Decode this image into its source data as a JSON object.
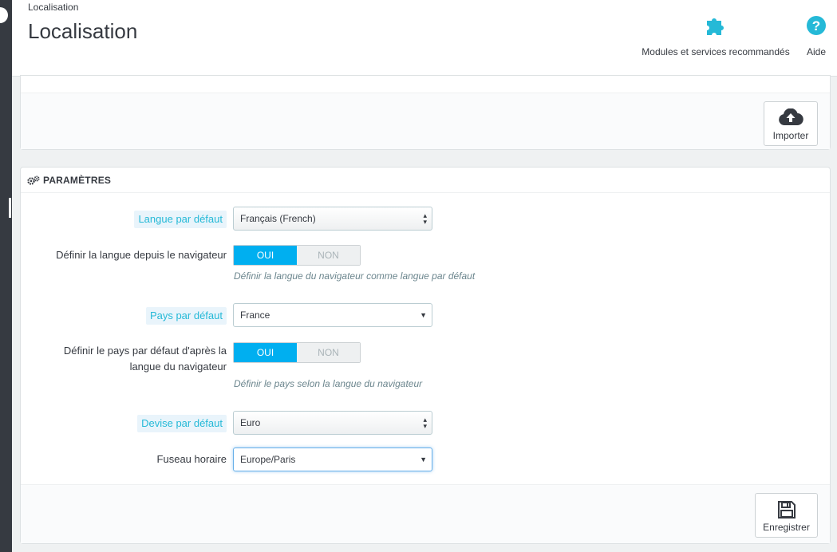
{
  "header": {
    "breadcrumb": "Localisation",
    "title": "Localisation",
    "toolbar": {
      "modules_label": "Modules et services recommandés",
      "help_label": "Aide"
    }
  },
  "import_panel": {
    "import_label": "Importer"
  },
  "params_panel": {
    "heading": "PARAMÈTRES",
    "fields": {
      "default_language": {
        "label": "Langue par défaut",
        "value": "Français (French)"
      },
      "browser_language": {
        "label": "Définir la langue depuis le navigateur",
        "on": "OUI",
        "off": "NON",
        "help": "Définir la langue du navigateur comme langue par défaut"
      },
      "default_country": {
        "label": "Pays par défaut",
        "value": "France"
      },
      "browser_country": {
        "label_line1": "Définir le pays par défaut d'après la",
        "label_line2": "langue du navigateur",
        "on": "OUI",
        "off": "NON",
        "help": "Définir le pays selon la langue du navigateur"
      },
      "default_currency": {
        "label": "Devise par défaut",
        "value": "Euro"
      },
      "timezone": {
        "label": "Fuseau horaire",
        "value": "Europe/Paris"
      }
    },
    "save_label": "Enregistrer"
  },
  "colors": {
    "accent": "#25b9d7",
    "switch_on": "#00aff0",
    "sidebar": "#363a41"
  }
}
